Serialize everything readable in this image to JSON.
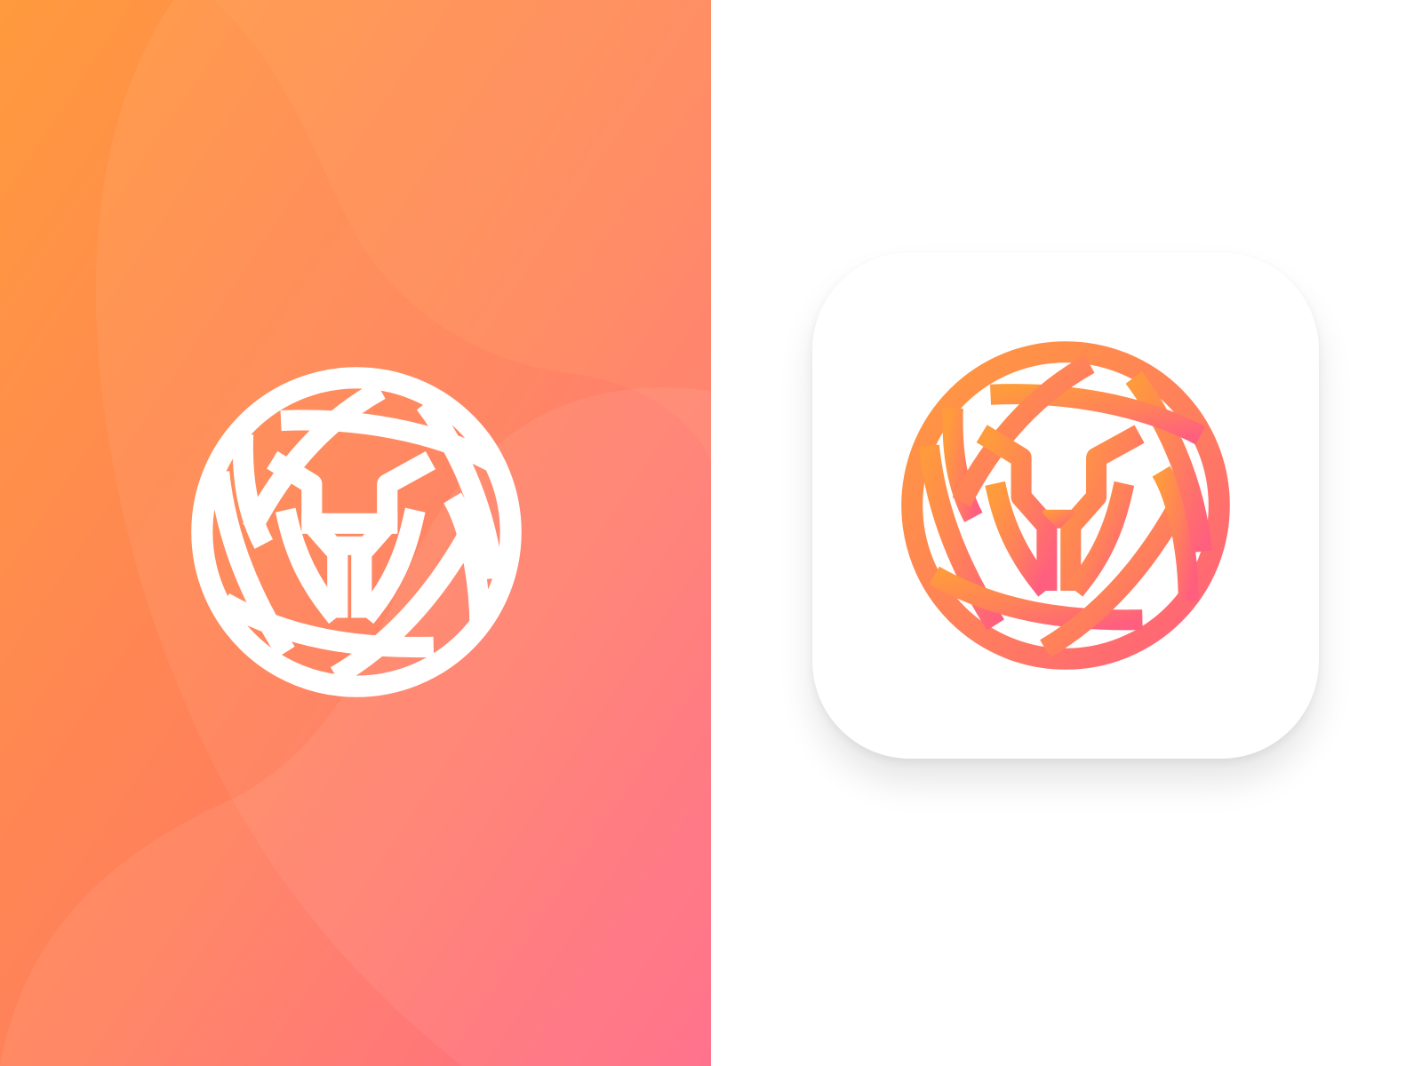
{
  "brand": {
    "mark_name": "lion-aperture-logo",
    "colors": {
      "gradient_start": "#FF9A3D",
      "gradient_mid": "#FF7F5C",
      "gradient_end": "#FF5F7E",
      "mark_on_gradient": "#FFFFFF",
      "icon_background": "#FFFFFF"
    }
  },
  "panels": [
    {
      "id": "left",
      "variant": "white mark on orange-to-pink gradient"
    },
    {
      "id": "right",
      "variant": "gradient mark on white rounded app icon"
    }
  ]
}
